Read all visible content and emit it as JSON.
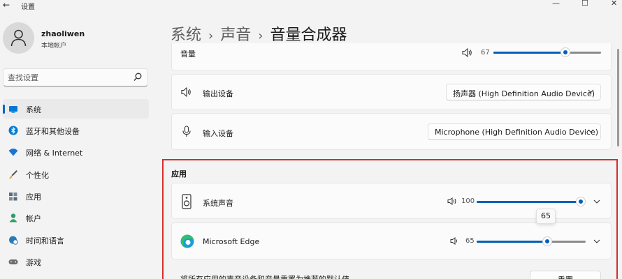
{
  "window": {
    "title": "设置",
    "back": "←",
    "minimize": "—",
    "maximize": "☐",
    "close": "✕"
  },
  "user": {
    "name": "zhaoliwen",
    "account_type": "本地帐户"
  },
  "search": {
    "placeholder": "查找设置"
  },
  "sidebar": {
    "items": [
      {
        "label": "系统",
        "icon": "monitor-icon",
        "active": true
      },
      {
        "label": "蓝牙和其他设备",
        "icon": "bluetooth-icon"
      },
      {
        "label": "网络 & Internet",
        "icon": "wifi-icon"
      },
      {
        "label": "个性化",
        "icon": "brush-icon"
      },
      {
        "label": "应用",
        "icon": "apps-icon"
      },
      {
        "label": "帐户",
        "icon": "person-icon"
      },
      {
        "label": "时间和语言",
        "icon": "globe-clock-icon"
      },
      {
        "label": "游戏",
        "icon": "gamepad-icon"
      }
    ]
  },
  "breadcrumb": {
    "level1": "系统",
    "level2": "声音",
    "current": "音量合成器",
    "separator": "›"
  },
  "volume": {
    "label": "音量",
    "value": "67",
    "level": 67
  },
  "output": {
    "label": "输出设备",
    "device": "扬声器 (High Definition Audio Device)"
  },
  "input": {
    "label": "输入设备",
    "device": "Microphone (High Definition Audio Device)"
  },
  "apps": {
    "section_title": "应用",
    "items": [
      {
        "name": "系统声音",
        "value": "100",
        "level": 100,
        "icon": "speaker-device-icon"
      },
      {
        "name": "Microsoft Edge",
        "value": "65",
        "level": 65,
        "icon": "edge-icon"
      }
    ],
    "tooltip": "65"
  },
  "reset": {
    "text": "将所有应用的声音设备和音量重置为推荐的默认值",
    "button": "重置"
  },
  "colors": {
    "accent": "#005fb8",
    "highlight_border": "#d32f2f",
    "sidebar_indicator": "#0067c0"
  }
}
